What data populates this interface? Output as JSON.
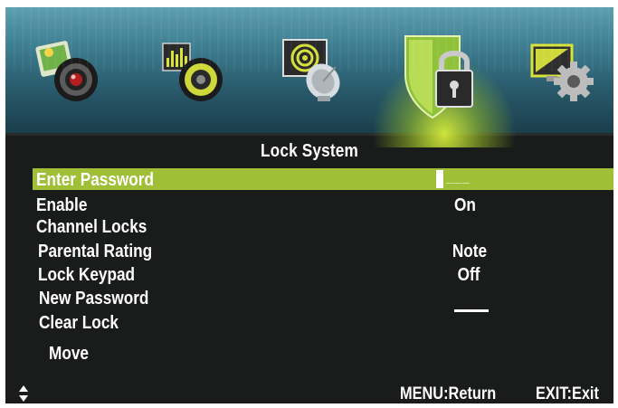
{
  "icons": {
    "picture": "picture-camera-icon",
    "sound": "sound-speaker-icon",
    "channel": "channel-satellite-icon",
    "lock": "lock-shield-icon",
    "setup": "setup-gear-icon"
  },
  "colors": {
    "highlight": "#9fbf37",
    "background": "#1a1b1b",
    "text": "#ffffff"
  },
  "menu": {
    "title": "Lock System",
    "items": [
      {
        "label": "Enter Password",
        "value": "___"
      },
      {
        "label": "Enable",
        "value": "On"
      },
      {
        "label": "Channel Locks",
        "value": ""
      },
      {
        "label": "Parental Rating",
        "value": "Note"
      },
      {
        "label": "Lock Keypad",
        "value": "Off"
      },
      {
        "label": "New Password",
        "value": ""
      },
      {
        "label": "Clear Lock",
        "value": ""
      }
    ]
  },
  "footer": {
    "move": "Move",
    "menu_return": "MENU:Return",
    "exit": "EXIT:Exit"
  }
}
